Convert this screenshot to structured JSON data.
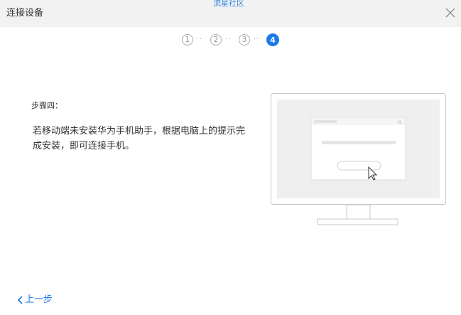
{
  "window": {
    "title": "连接设备",
    "watermark": "流星社区",
    "close_icon": "close-icon"
  },
  "stepper": {
    "steps": [
      "1",
      "2",
      "3",
      "4"
    ],
    "separator": "··",
    "current_step": "4"
  },
  "content": {
    "step_label": "步骤四：",
    "instruction": "若移动端未安装华为手机助手，根据电脑上的提示完成安装，即可连接手机。"
  },
  "illustration": {
    "icon": "monitor-install-dialog-illustration",
    "cursor_icon": "mouse-pointer-icon"
  },
  "footer": {
    "back_label": "上一步",
    "back_icon": "chevron-left-icon"
  },
  "colors": {
    "accent": "#1a7ae8",
    "titlebar_bg": "#f2f2f2",
    "text": "#333333"
  }
}
